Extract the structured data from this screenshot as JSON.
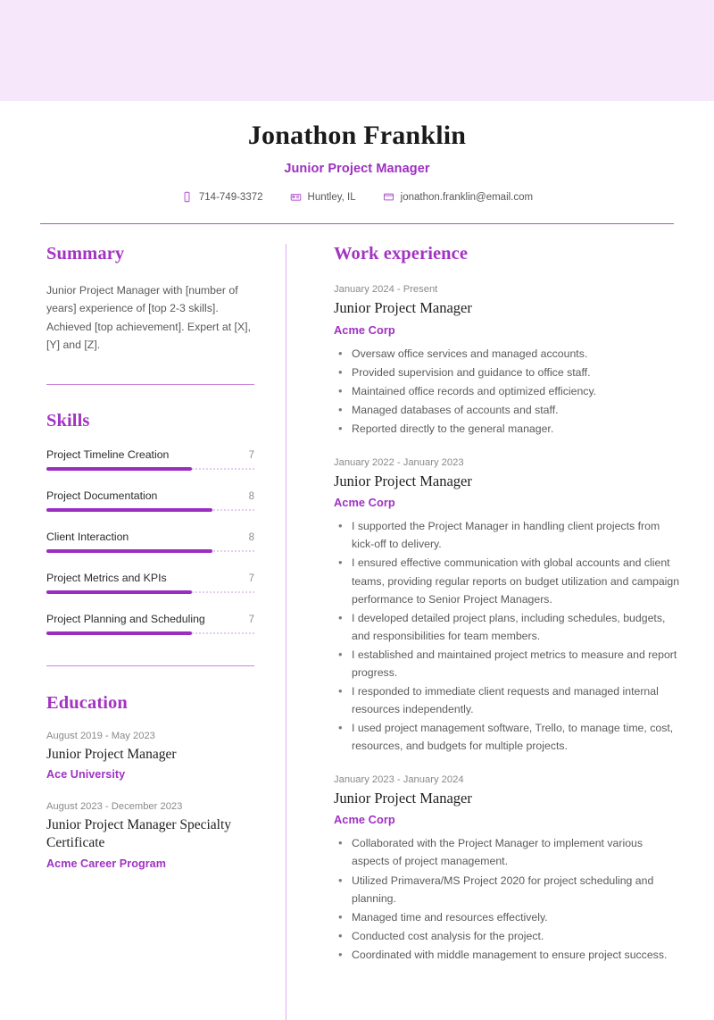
{
  "theme": {
    "banner_color": "#f6e7fb",
    "accent_color": "#a031c4",
    "heading_color": "#a333c2",
    "rule_color": "#c986dd",
    "divider_color": "#ddaeee",
    "bar_fill_color": "#9b2ec0",
    "bar_track_color": "#e4cdee",
    "body_text_color": "#5b5b5b",
    "muted_text_color": "#8a8a8a"
  },
  "header": {
    "full_name": "Jonathon Franklin",
    "job_title": "Junior Project Manager",
    "contacts": [
      {
        "icon": "phone-icon",
        "value": "714-749-3372"
      },
      {
        "icon": "city-location-icon",
        "value": "Huntley, IL"
      },
      {
        "icon": "envelope-icon",
        "value": "jonathon.franklin@email.com"
      }
    ]
  },
  "left_column": {
    "summary": {
      "heading": "Summary",
      "text": "Junior Project Manager with [number of years] experience of [top 2-3 skills]. Achieved [top achievement]. Expert at [X], [Y] and [Z]."
    },
    "skills": {
      "heading": "Skills",
      "scale_max": 10,
      "items": [
        {
          "name": "Project Timeline Creation",
          "value": 7
        },
        {
          "name": "Project Documentation",
          "value": 8
        },
        {
          "name": "Client Interaction",
          "value": 8
        },
        {
          "name": "Project Metrics and KPIs",
          "value": 7
        },
        {
          "name": "Project Planning and Scheduling",
          "value": 7
        }
      ]
    },
    "education": {
      "heading": "Education",
      "entries": [
        {
          "date": "August 2019 - May 2023",
          "title": "Junior Project Manager",
          "organization": "Ace University"
        },
        {
          "date": "August 2023 - December 2023",
          "title": "Junior Project Manager Specialty Certificate",
          "organization": "Acme Career Program"
        }
      ]
    }
  },
  "right_column": {
    "work_experience": {
      "heading": "Work experience",
      "jobs": [
        {
          "date": "January 2024 - Present",
          "title": "Junior Project Manager",
          "organization": "Acme Corp",
          "bullets": [
            "Oversaw office services and managed accounts.",
            "Provided supervision and guidance to office staff.",
            "Maintained office records and optimized efficiency.",
            "Managed databases of accounts and staff.",
            "Reported directly to the general manager."
          ]
        },
        {
          "date": "January 2022 - January 2023",
          "title": "Junior Project Manager",
          "organization": "Acme Corp",
          "bullets": [
            "I supported the Project Manager in handling client projects from kick-off to delivery.",
            "I ensured effective communication with global accounts and client teams, providing regular reports on budget utilization and campaign performance to Senior Project Managers.",
            "I developed detailed project plans, including schedules, budgets, and responsibilities for team members.",
            "I established and maintained project metrics to measure and report progress.",
            "I responded to immediate client requests and managed internal resources independently.",
            "I used project management software, Trello, to manage time, cost, resources, and budgets for multiple projects."
          ]
        },
        {
          "date": "January 2023 - January 2024",
          "title": "Junior Project Manager",
          "organization": "Acme Corp",
          "bullets": [
            "Collaborated with the Project Manager to implement various aspects of project management.",
            "Utilized Primavera/MS Project 2020 for project scheduling and planning.",
            "Managed time and resources effectively.",
            "Conducted cost analysis for the project.",
            "Coordinated with middle management to ensure project success."
          ]
        }
      ]
    }
  }
}
